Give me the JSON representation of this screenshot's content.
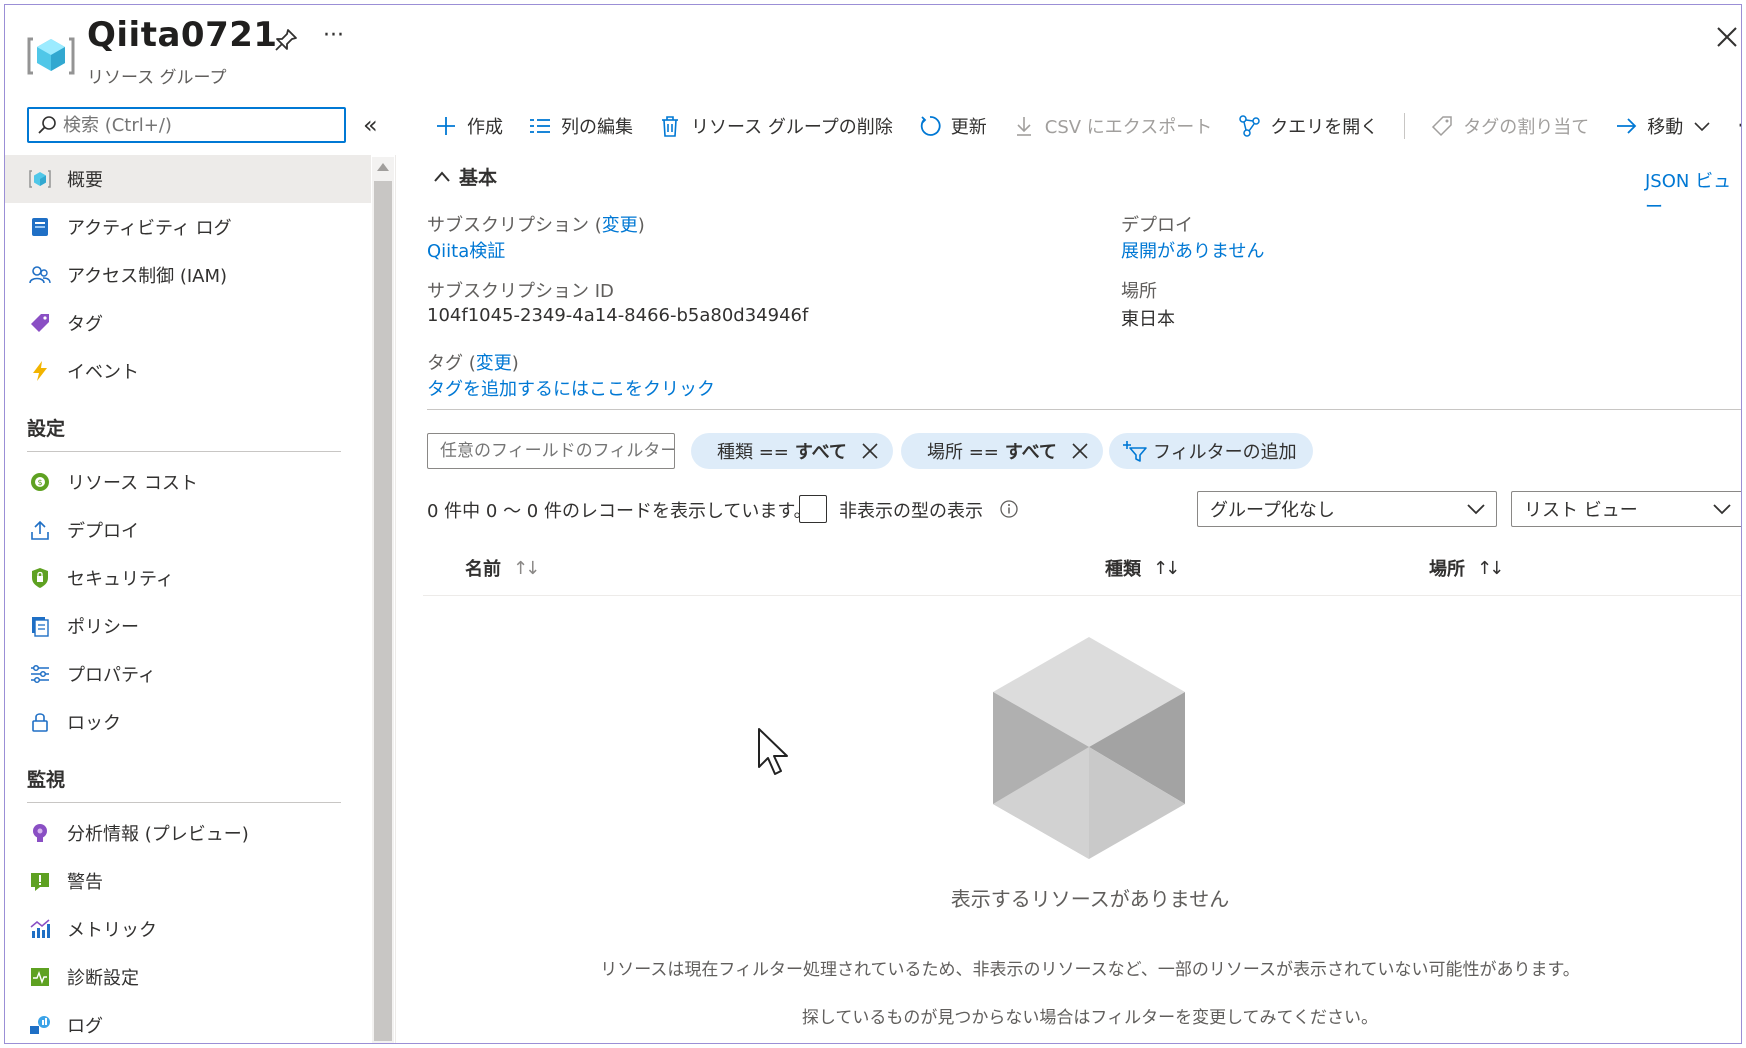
{
  "header": {
    "title": "Qiita0721",
    "subtitle": "リソース グループ",
    "more": "···"
  },
  "search": {
    "placeholder": "検索 (Ctrl+/)",
    "collapse": "«"
  },
  "sidebar": {
    "items": [
      {
        "label": "概要",
        "icon": "resource-group-icon"
      },
      {
        "label": "アクティビティ ログ",
        "icon": "activity-log-icon"
      },
      {
        "label": "アクセス制御 (IAM)",
        "icon": "people-icon"
      },
      {
        "label": "タグ",
        "icon": "tag-icon"
      },
      {
        "label": "イベント",
        "icon": "lightning-icon"
      }
    ],
    "section_settings": "設定",
    "settings": [
      {
        "label": "リソース コスト",
        "icon": "cost-icon"
      },
      {
        "label": "デプロイ",
        "icon": "upload-icon"
      },
      {
        "label": "セキュリティ",
        "icon": "shield-icon"
      },
      {
        "label": "ポリシー",
        "icon": "policy-icon"
      },
      {
        "label": "プロパティ",
        "icon": "sliders-icon"
      },
      {
        "label": "ロック",
        "icon": "lock-icon"
      }
    ],
    "section_monitoring": "監視",
    "monitoring": [
      {
        "label": "分析情報 (プレビュー)",
        "icon": "bulb-icon"
      },
      {
        "label": "警告",
        "icon": "alert-icon"
      },
      {
        "label": "メトリック",
        "icon": "metrics-icon"
      },
      {
        "label": "診断設定",
        "icon": "diagnostics-icon"
      },
      {
        "label": "ログ",
        "icon": "logs-icon"
      }
    ]
  },
  "toolbar": {
    "create": "作成",
    "edit_columns": "列の編集",
    "delete_group": "リソース グループの削除",
    "refresh": "更新",
    "export_csv": "CSV にエクスポート",
    "open_query": "クエリを開く",
    "assign_tags": "タグの割り当て",
    "move": "移動",
    "more": "···"
  },
  "essentials": {
    "heading": "基本",
    "json_view": "JSON ビュー",
    "subscription_label": "サブスクリプション",
    "change": "変更",
    "subscription_value": "Qiita検証",
    "subscription_id_label": "サブスクリプション ID",
    "subscription_id_value": "104f1045-2349-4a14-8466-b5a80d34946f",
    "tags_label": "タグ",
    "tags_value": "タグを追加するにはここをクリック",
    "deploy_label": "デプロイ",
    "deploy_value": "展開がありません",
    "location_label": "場所",
    "location_value": "東日本"
  },
  "filters": {
    "placeholder": "任意のフィールドのフィルター...",
    "type_pill_key": "種類 ==",
    "type_pill_val": "すべて",
    "location_pill_key": "場所 ==",
    "location_pill_val": "すべて",
    "add_filter": "フィルターの追加"
  },
  "list": {
    "records": "0 件中 0 ～ 0 件のレコードを表示しています。",
    "show_hidden": "非表示の型の表示",
    "grouping": "グループ化なし",
    "view": "リスト ビュー",
    "columns": [
      "名前",
      "種類",
      "場所"
    ],
    "sort_glyph": "↑↓"
  },
  "empty": {
    "title": "表示するリソースがありません",
    "message1": "リソースは現在フィルター処理されているため、非表示のリソースなど、一部のリソースが表示されていない可能性があります。",
    "message2": "探しているものが見つからない場合はフィルターを変更してみてください。"
  },
  "colors": {
    "accent": "#0078d4",
    "pill": "#deecf9",
    "active_nav": "#edebe9"
  }
}
